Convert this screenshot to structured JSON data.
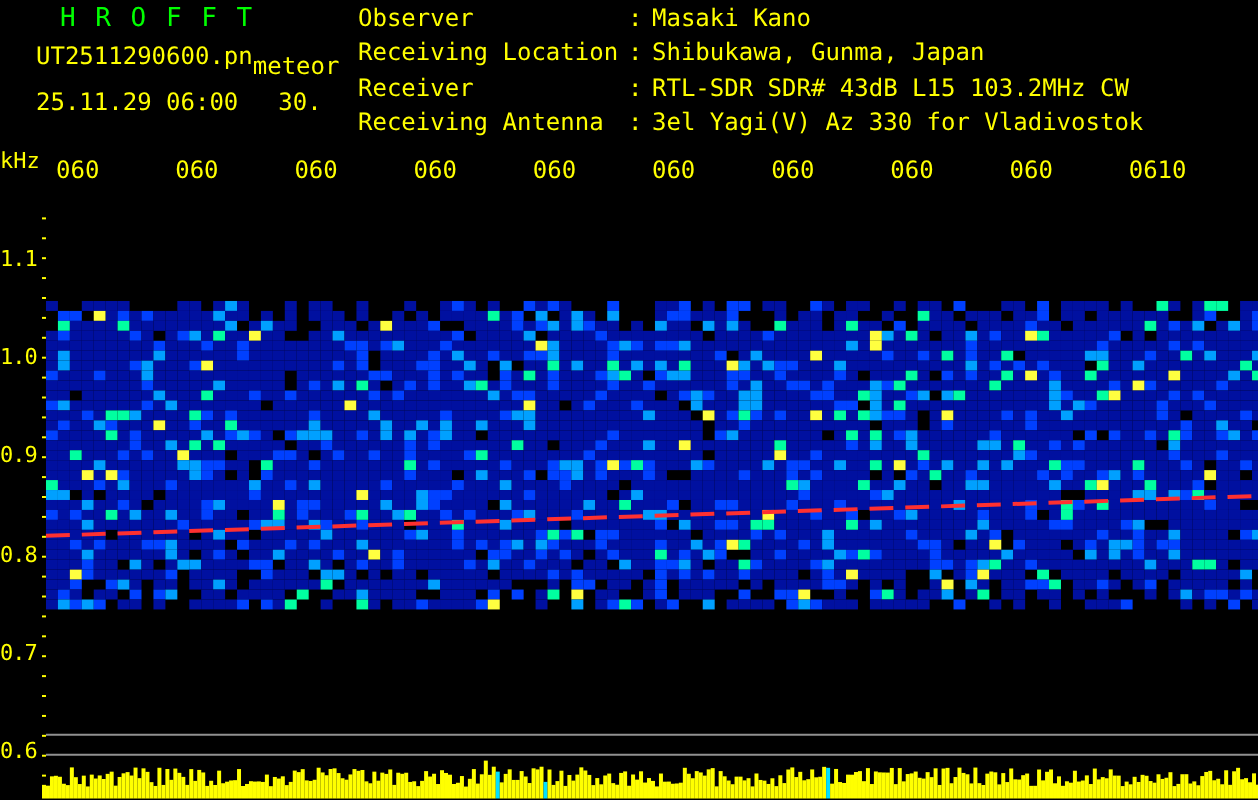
{
  "app_title": "H R O F F T",
  "file": {
    "name": "UT2511290600.pn",
    "tag": "meteor",
    "datetime": "25.11.29 06:00",
    "value": "30."
  },
  "info": [
    {
      "label": "Observer",
      "separator": ":",
      "value": "Masaki Kano"
    },
    {
      "label": "Receiving Location",
      "separator": ":",
      "value": "Shibukawa, Gunma, Japan"
    },
    {
      "label": "Receiver",
      "separator": ":",
      "value": "RTL-SDR SDR# 43dB L15 103.2MHz CW"
    },
    {
      "label": "Receiving Antenna",
      "separator": ":",
      "value": "3el Yagi(V) Az 330 for Vladivostok"
    }
  ],
  "y_unit": "kHz",
  "time_labels": [
    "060",
    "060",
    "060",
    "060",
    "060",
    "060",
    "060",
    "060",
    "060",
    "0610"
  ],
  "y_labels": [
    "1.1",
    "1.0",
    "0.9",
    "0.8",
    "0.7",
    "0.6"
  ]
}
